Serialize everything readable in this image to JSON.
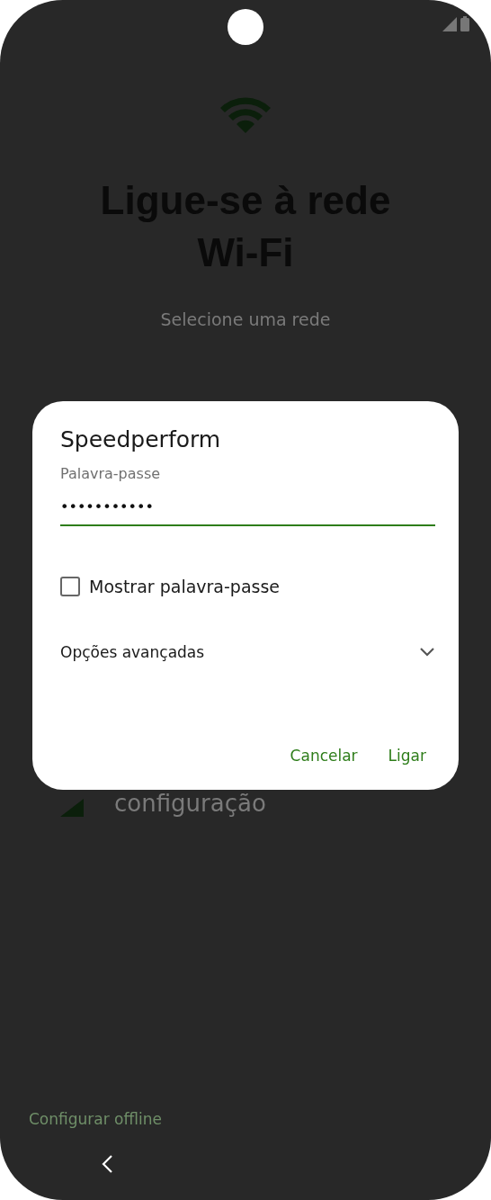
{
  "header": {
    "title": "Ligue-se à rede Wi-Fi",
    "subtitle": "Selecione uma rede"
  },
  "background_items": [
    {
      "text": "configuração"
    }
  ],
  "offline_link": "Configurar offline",
  "dialog": {
    "title": "Speedperform",
    "field": {
      "label": "Palavra-passe",
      "value": "•••••••••••"
    },
    "show_password": {
      "label": "Mostrar palavra-passe",
      "checked": false
    },
    "advanced": {
      "label": "Opções avançadas",
      "expanded": false
    },
    "buttons": [
      "Cancelar",
      "Ligar"
    ]
  }
}
